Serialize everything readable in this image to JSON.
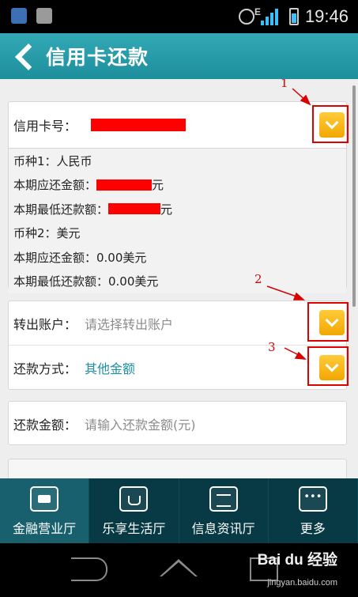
{
  "status_bar": {
    "time": "19:46",
    "network": "E"
  },
  "header": {
    "title": "信用卡还款"
  },
  "card_section": {
    "label": "信用卡号：",
    "details": [
      "币种1：人民币",
      "本期应还金额：",
      "元",
      "本期最低还款额：",
      "元",
      "币种2：美元",
      "本期应还金额：0.00美元",
      "本期最低还款额：0.00美元"
    ]
  },
  "transfer_account": {
    "label": "转出账户：",
    "placeholder": "请选择转出账户"
  },
  "repay_method": {
    "label": "还款方式：",
    "value": "其他金额"
  },
  "repay_amount": {
    "label": "还款金额：",
    "placeholder": "请输入还款金额(元)"
  },
  "annotations": [
    "1",
    "2",
    "3"
  ],
  "bottom_nav": {
    "tabs": [
      {
        "label": "金融营业厅",
        "icon": "briefcase-icon"
      },
      {
        "label": "乐享生活厅",
        "icon": "cup-icon"
      },
      {
        "label": "信息资讯厅",
        "icon": "newspaper-icon"
      },
      {
        "label": "更多",
        "icon": "more-icon"
      }
    ]
  },
  "watermark": {
    "brand": "Bai du 经验",
    "url": "jingyan.baidu.com"
  },
  "colors": {
    "accent": "#1e8fa2",
    "dropdown": "#f2a800",
    "annotation": "#e00000",
    "nav_bg": "#073a45"
  }
}
